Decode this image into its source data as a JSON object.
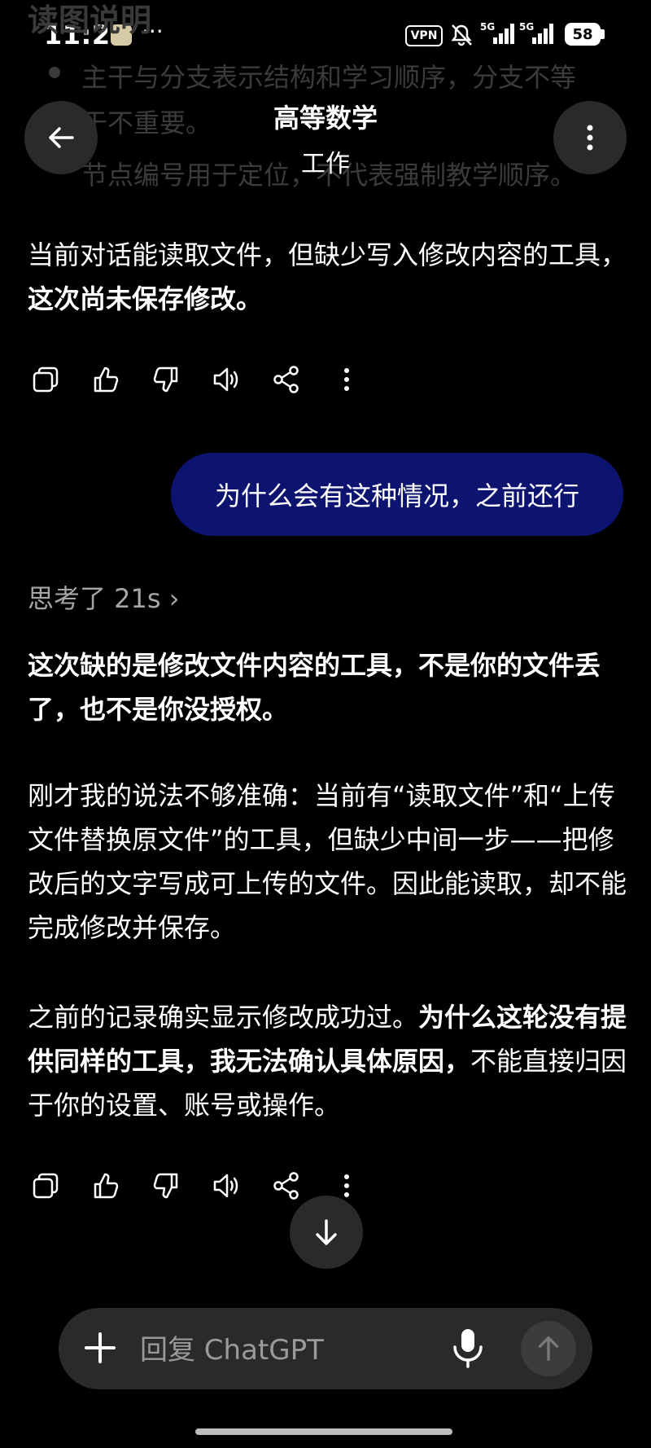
{
  "status_bar": {
    "time": "11:25",
    "more": "···",
    "vpn": "VPN",
    "net1": "5G",
    "net2": "5G",
    "battery": "58"
  },
  "background_faded": {
    "title": "读图说明",
    "line1": "主干与分支表示结构和学习顺序，分支不等",
    "line2": "于不重要。",
    "line3": "节点编号用于定位，不代表强制教学顺序。"
  },
  "header": {
    "title": "高等数学",
    "subtitle": "工作"
  },
  "assistant_msg1": {
    "text_normal": "当前对话能读取文件，但缺少写入修改内容的工具，",
    "text_bold": "这次尚未保存修改。"
  },
  "user_msg": {
    "text": "为什么会有这种情况，之前还行"
  },
  "thinking": {
    "label": "思考了 21s",
    "chevron": "›"
  },
  "assistant_msg2": {
    "p1_bold": "这次缺的是修改文件内容的工具，不是你的文件丢了，也不是你没授权。",
    "p2": "刚才我的说法不够准确：当前有“读取文件”和“上传文件替换原文件”的工具，但缺少中间一步——把修改后的文字写成可上传的文件。因此能读取，却不能完成修改并保存。",
    "p3_normal_a": "之前的记录确实显示修改成功过。",
    "p3_bold": "为什么这轮没有提供同样的工具，我无法确认具体原因，",
    "p3_normal_b": "不能直接归因于你的设置、账号或操作。"
  },
  "composer": {
    "placeholder": "回复 ChatGPT"
  },
  "icons": [
    "back-arrow-icon",
    "more-vertical-icon",
    "copy-icon",
    "thumbs-up-icon",
    "thumbs-down-icon",
    "speaker-icon",
    "share-icon",
    "more-icon",
    "arrow-down-icon",
    "plus-icon",
    "mic-icon",
    "arrow-up-icon"
  ]
}
